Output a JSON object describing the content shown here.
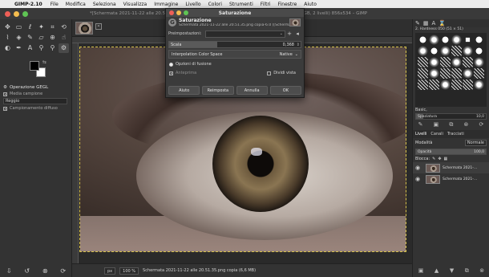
{
  "menubar": {
    "app_name": "GIMP-2.10",
    "items": [
      "File",
      "Modifica",
      "Seleziona",
      "Visualizza",
      "Immagine",
      "Livello",
      "Colori",
      "Strumenti",
      "Filtri",
      "Finestre",
      "Aiuto"
    ]
  },
  "window": {
    "title": "*[Schermata 2021-11-22 alle 20.51.35.png copia]-6.0 (Colore RGB 8 bit gamma, GIMP built-in sRGB, 2 livelli) 856x534 – GIMP"
  },
  "toolbox": {
    "options_title": "Operazione GEGL",
    "sample_merged_label": "Media campione",
    "sample_value": "Reggio",
    "diffuse_label": "Campionamento diffuso"
  },
  "dialog": {
    "window_title": "Saturazione",
    "header_title": "Saturazione",
    "header_subtitle": "Schermata 2021-11-22 alle 20.51.35.png copia-6.0 ([Schermat...",
    "presets_label": "Preimpostazioni:",
    "scale_label": "Scala",
    "scale_value": "0,368",
    "scale_fraction": 0.368,
    "interp_label": "Interpolation Color Space",
    "interp_value": "Native",
    "blend_label": "Opzioni di fusione",
    "preview_label": "Anteprima",
    "split_label": "Dividi vista",
    "buttons": {
      "help": "Aiuto",
      "reset": "Reimposta",
      "cancel": "Annulla",
      "ok": "OK"
    }
  },
  "statusbar": {
    "unit": "px",
    "zoom": "100 %",
    "file": "Schermata 2021-11-22 alle 20.51.35.png copia (6,6 MB)"
  },
  "dock": {
    "brush_name": "2. Hardness 050 (51 × 51)",
    "preset_label": "Basic,",
    "spacing_label": "Spaziatura",
    "spacing_value": "10,0",
    "tabs": [
      "Livelli",
      "Canali",
      "Tracciati"
    ],
    "mode_label": "Modalità",
    "mode_value": "Normale",
    "opacity_label": "Opacità",
    "opacity_value": "100,0",
    "lock_label": "Blocca:",
    "layers": [
      {
        "name": "Schermata 2021-..."
      },
      {
        "name": "Schermata 2021-..."
      }
    ]
  },
  "colors": {
    "menubar_bg": "#ececec",
    "ui_bg": "#333333",
    "selection_border": "#d6c24a"
  }
}
